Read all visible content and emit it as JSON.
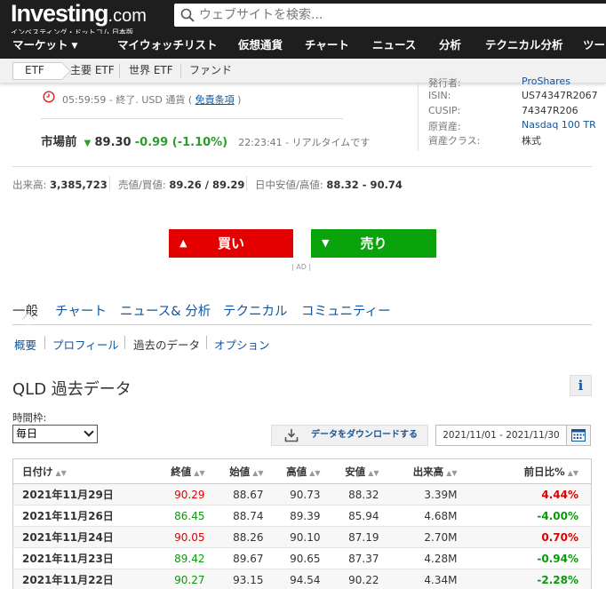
{
  "header": {
    "logo_main": "Investing",
    "logo_dotcom": ".com",
    "logo_sub": "インベスティング・ドットコム 日本版",
    "search_placeholder": "ウェブサイトを検索..."
  },
  "nav": {
    "items": [
      "マーケット",
      "マイウォッチリスト",
      "仮想通貨",
      "チャート",
      "ニュース",
      "分析",
      "テクニカル分析",
      "ツー"
    ]
  },
  "subnav": {
    "items": [
      "ETF",
      "主要 ETF",
      "世界 ETF",
      "ファンド"
    ]
  },
  "quote": {
    "close_text": "05:59:59 - 終了. USD 通貨 (",
    "disclaimer_link": "免責条項",
    "close_suffix": ")",
    "market_label": "市場前",
    "pre_price": "89.30",
    "pre_change": "-0.99 (-1.10%)",
    "rt_time": "22:23:41 - リアルタイムです"
  },
  "instrument": {
    "rows": [
      {
        "label": "発行者:",
        "value": "ProShares"
      },
      {
        "label": "ISIN:",
        "value": "US74347R2067"
      },
      {
        "label": "CUSIP:",
        "value": "74347R206"
      },
      {
        "label": "原資産:",
        "value": "Nasdaq 100 TR"
      },
      {
        "label": "資産クラス:",
        "value": "株式"
      }
    ]
  },
  "stats": {
    "volume_label": "出来高:",
    "volume_value": "3,385,723",
    "bidask_label": "売値/買値:",
    "bidask_value": "89.26 / 89.29",
    "range_label": "日中安値/高値:",
    "range_value": "88.32 - 90.74"
  },
  "trade": {
    "buy_label": "買い",
    "sell_label": "売り",
    "ad_label": "| AD |"
  },
  "tabs": {
    "main": [
      "一般",
      "チャート",
      "ニュース& 分析",
      "テクニカル",
      "コミュニティー"
    ],
    "sub": [
      "概要",
      "プロフィール",
      "過去のデータ",
      "オプション"
    ]
  },
  "history": {
    "title": "QLD 過去データ",
    "info_icon_label": "i",
    "timeframe_label": "時間枠:",
    "timeframe_value": "毎日",
    "download_label": "データをダウンロードする",
    "date_range": "2021/11/01 - 2021/11/30",
    "columns": [
      "日付け",
      "終値",
      "始値",
      "高値",
      "安値",
      "出来高",
      "前日比%"
    ],
    "rows": [
      {
        "date": "2021年11月29日",
        "close": "90.29",
        "open": "88.67",
        "high": "90.73",
        "low": "88.32",
        "vol": "3.39M",
        "chg": "4.44%",
        "dir": "up"
      },
      {
        "date": "2021年11月26日",
        "close": "86.45",
        "open": "88.74",
        "high": "89.39",
        "low": "85.94",
        "vol": "4.68M",
        "chg": "-4.00%",
        "dir": "down"
      },
      {
        "date": "2021年11月24日",
        "close": "90.05",
        "open": "88.26",
        "high": "90.10",
        "low": "87.19",
        "vol": "2.70M",
        "chg": "0.70%",
        "dir": "up"
      },
      {
        "date": "2021年11月23日",
        "close": "89.42",
        "open": "89.67",
        "high": "90.65",
        "low": "87.37",
        "vol": "4.28M",
        "chg": "-0.94%",
        "dir": "down"
      },
      {
        "date": "2021年11月22日",
        "close": "90.27",
        "open": "93.15",
        "high": "94.54",
        "low": "90.22",
        "vol": "4.34M",
        "chg": "-2.28%",
        "dir": "down"
      }
    ]
  },
  "colors": {
    "header_bg": "#1e1e1e",
    "buy": "#e30000",
    "sell": "#0ba30b",
    "link": "#1256a0",
    "up": "#e00000",
    "down": "#0a9a0a"
  }
}
